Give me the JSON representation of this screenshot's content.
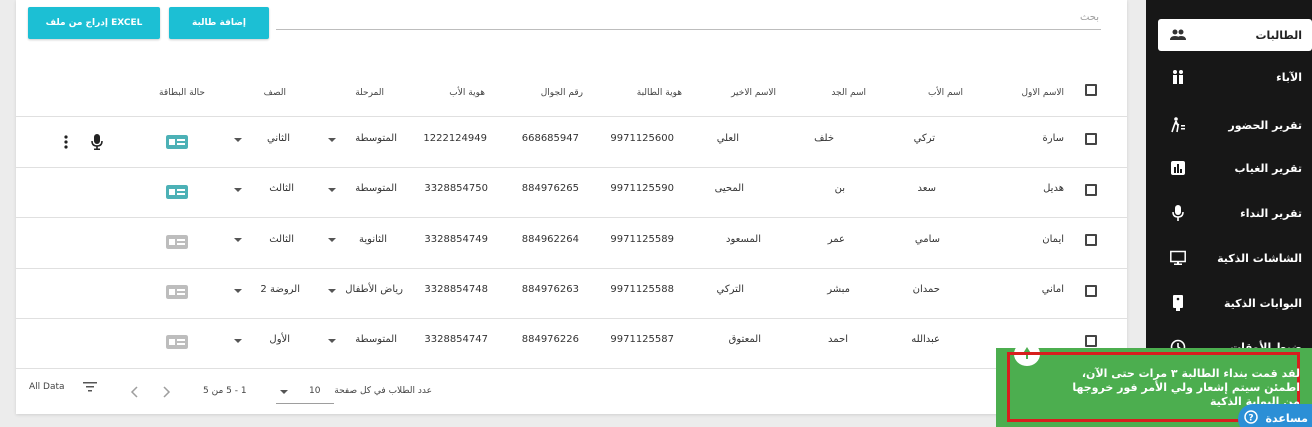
{
  "toolbar": {
    "excel_label": "EXCEL إدراج من ملف",
    "add_label": "إضافة طالبة",
    "search_placeholder": "بحث"
  },
  "table": {
    "headers": [
      "الاسم الاول",
      "اسم الأب",
      "اسم الجد",
      "الاسم الاخير",
      "هوية الطالبة",
      "رقم الجوال",
      "هوية الأب",
      "المرحلة",
      "الصف",
      "حالة البطاقة"
    ],
    "rows": [
      [
        "سارة",
        "تركي",
        "خلف",
        "العلي",
        "9971125600",
        "668685947",
        "1222124949",
        "المتوسطة",
        "الثاني"
      ],
      [
        "هديل",
        "سعد",
        "بن",
        "المحيى",
        "9971125590",
        "884976265",
        "3328854750",
        "المتوسطة",
        "الثالث"
      ],
      [
        "ايمان",
        "سامي",
        "عمر",
        "المسعود",
        "9971125589",
        "884962264",
        "3328854749",
        "الثانوية",
        "الثالث"
      ],
      [
        "اماني",
        "حمدان",
        "مبشر",
        "التركي",
        "9971125588",
        "884976263",
        "3328854748",
        "رياض الأطفال",
        "الروضة 2"
      ],
      [
        "",
        "عبدالله",
        "احمد",
        "المعتوق",
        "9971125587",
        "884976226",
        "3328854747",
        "المتوسطة",
        "الأول"
      ]
    ]
  },
  "footer": {
    "per_page_label": "عدد الطلاب في كل صفحة",
    "per_page_value": "10",
    "range": "1 - 5 من 5",
    "all_data": "All Data"
  },
  "sidebar": {
    "items": [
      {
        "label": "الطالبات",
        "icon": "people-icon"
      },
      {
        "label": "الآباء",
        "icon": "family-icon"
      },
      {
        "label": "تقرير الحضور",
        "icon": "walking-icon"
      },
      {
        "label": "تقرير الغياب",
        "icon": "chart-icon"
      },
      {
        "label": "تقرير النداء",
        "icon": "microphone-icon"
      },
      {
        "label": "الشاشات الذكية",
        "icon": "monitor-icon"
      },
      {
        "label": "البوابات الذكية",
        "icon": "gate-icon"
      },
      {
        "label": "ضبط الأوقات",
        "icon": "clock-icon"
      }
    ]
  },
  "toast": {
    "line1": "لقد قمت بنداء الطالبة ٣ مرات حتى الآن،",
    "line2": "اطمئن سيتم إشعار ولي الأمر فور خروجها",
    "line3": "من البوابة الذكية"
  },
  "help": {
    "label": "مساعدة"
  },
  "colors": {
    "accent": "#1cbfd4",
    "sidebar": "#171717",
    "toast": "#4cae4f",
    "toast_border": "#d81e1e",
    "card_active": "#4cb1b6",
    "card_inactive": "#bdbdbd"
  }
}
